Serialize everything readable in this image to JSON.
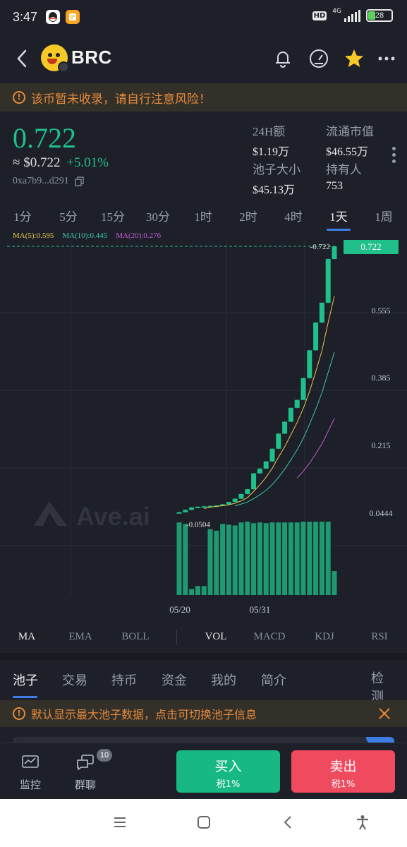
{
  "status_bar": {
    "time": "3:47",
    "network": "4G",
    "battery": "28"
  },
  "header": {
    "token_symbol": "BRC",
    "icons": [
      "back-icon",
      "bell-icon",
      "gauge-icon",
      "star-icon",
      "more-icon"
    ]
  },
  "warning": {
    "text": "该币暂未收录，请自行注意风险！"
  },
  "price": {
    "value": "0.722",
    "usd_prefix": "≈",
    "usd_value": "$0.722",
    "change": "+5.01%",
    "address": "0xa7b9...d291"
  },
  "stats": [
    {
      "label": "24H额",
      "value": "$1.19万"
    },
    {
      "label": "流通市值",
      "value": "$46.55万"
    },
    {
      "label": "池子大小",
      "value": "$45.13万"
    },
    {
      "label": "持有人",
      "value": "753"
    }
  ],
  "timeframes": [
    "1分",
    "5分",
    "15分",
    "30分",
    "1时",
    "2时",
    "4时",
    "1天",
    "1周"
  ],
  "active_timeframe": "1天",
  "ma_legend": [
    {
      "label": "MA(5):0.595",
      "color": "#e8c54a"
    },
    {
      "label": "MA(10):0.445",
      "color": "#3fc6a9"
    },
    {
      "label": "MA(20):0.276",
      "color": "#c85ad8"
    }
  ],
  "chart_data": {
    "type": "candlestick",
    "watermark": "Ave.ai",
    "y_ticks": [
      "0.722",
      "0.555",
      "0.385",
      "0.215",
      "0.0444"
    ],
    "current_price_label": "0.722",
    "max_label": "0.722",
    "min_label": "0.0504",
    "x_labels": [
      "05/20",
      "05/31"
    ],
    "candles": [
      {
        "o": 0.05,
        "c": 0.052,
        "h": 0.053,
        "l": 0.0504
      },
      {
        "o": 0.052,
        "c": 0.058,
        "h": 0.059,
        "l": 0.051
      },
      {
        "o": 0.058,
        "c": 0.064,
        "h": 0.065,
        "l": 0.057
      },
      {
        "o": 0.064,
        "c": 0.066,
        "h": 0.067,
        "l": 0.063
      },
      {
        "o": 0.066,
        "c": 0.067,
        "h": 0.068,
        "l": 0.065
      },
      {
        "o": 0.067,
        "c": 0.068,
        "h": 0.069,
        "l": 0.066
      },
      {
        "o": 0.068,
        "c": 0.069,
        "h": 0.07,
        "l": 0.067
      },
      {
        "o": 0.069,
        "c": 0.072,
        "h": 0.073,
        "l": 0.068
      },
      {
        "o": 0.072,
        "c": 0.078,
        "h": 0.079,
        "l": 0.071
      },
      {
        "o": 0.078,
        "c": 0.086,
        "h": 0.087,
        "l": 0.077
      },
      {
        "o": 0.086,
        "c": 0.098,
        "h": 0.099,
        "l": 0.085
      },
      {
        "o": 0.098,
        "c": 0.11,
        "h": 0.111,
        "l": 0.097
      },
      {
        "o": 0.11,
        "c": 0.15,
        "h": 0.151,
        "l": 0.109
      },
      {
        "o": 0.15,
        "c": 0.162,
        "h": 0.163,
        "l": 0.149
      },
      {
        "o": 0.162,
        "c": 0.18,
        "h": 0.181,
        "l": 0.161
      },
      {
        "o": 0.18,
        "c": 0.212,
        "h": 0.213,
        "l": 0.179
      },
      {
        "o": 0.212,
        "c": 0.25,
        "h": 0.251,
        "l": 0.211
      },
      {
        "o": 0.25,
        "c": 0.28,
        "h": 0.281,
        "l": 0.249
      },
      {
        "o": 0.28,
        "c": 0.315,
        "h": 0.316,
        "l": 0.279
      },
      {
        "o": 0.315,
        "c": 0.335,
        "h": 0.336,
        "l": 0.314
      },
      {
        "o": 0.335,
        "c": 0.39,
        "h": 0.391,
        "l": 0.334
      },
      {
        "o": 0.39,
        "c": 0.46,
        "h": 0.461,
        "l": 0.389
      },
      {
        "o": 0.46,
        "c": 0.53,
        "h": 0.531,
        "l": 0.459
      },
      {
        "o": 0.53,
        "c": 0.58,
        "h": 0.581,
        "l": 0.529
      },
      {
        "o": 0.58,
        "c": 0.69,
        "h": 0.691,
        "l": 0.579
      },
      {
        "o": 0.69,
        "c": 0.722,
        "h": 0.722,
        "l": 0.689
      }
    ],
    "volumes": [
      0.97,
      0.95,
      0.08,
      0.12,
      0.12,
      0.88,
      0.86,
      0.95,
      0.94,
      0.93,
      0.97,
      0.98,
      0.96,
      0.97,
      0.96,
      0.97,
      0.97,
      0.97,
      0.97,
      0.97,
      0.98,
      0.98,
      0.98,
      0.98,
      0.98,
      0.32
    ],
    "ma5_start_index": 4,
    "ma10_start_index": 9,
    "ma20_start_index": 19
  },
  "indicator_tabs": [
    "MA",
    "EMA",
    "BOLL",
    "VOL",
    "MACD",
    "KDJ",
    "RSI"
  ],
  "active_indicators": [
    "MA",
    "VOL"
  ],
  "sub_tabs": [
    "池子",
    "交易",
    "持币",
    "资金",
    "我的",
    "简介",
    "检测"
  ],
  "active_sub_tab": "池子",
  "notice": {
    "text": "默认显示最大池子数据，点击可切换池子信息"
  },
  "bottom_bar": {
    "monitor_label": "监控",
    "group_chat_label": "群聊",
    "group_chat_badge": "10",
    "buy_label": "买入",
    "buy_tax": "税1%",
    "sell_label": "卖出",
    "sell_tax": "税1%"
  },
  "colors": {
    "up": "#1fc08a",
    "down": "#f04a5e",
    "accent": "#3f7de6",
    "warning": "#e58a3a"
  }
}
